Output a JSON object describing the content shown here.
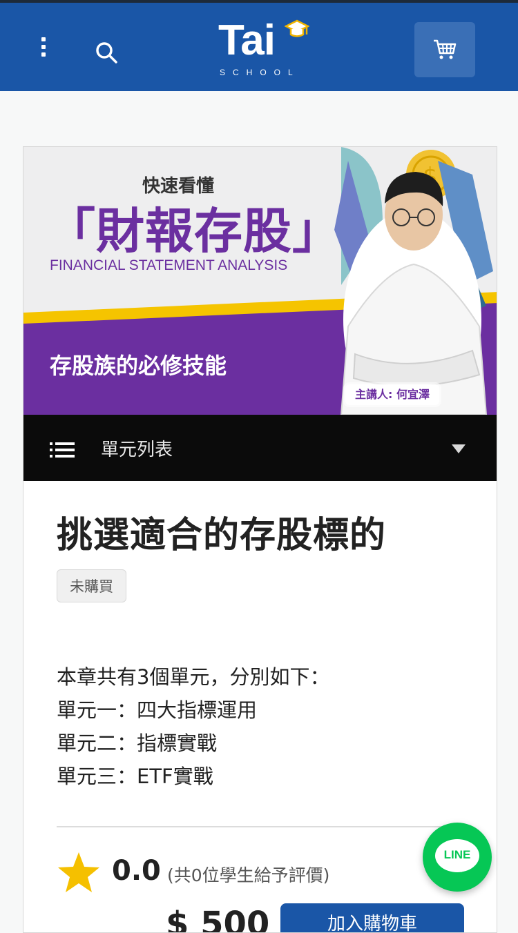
{
  "header": {
    "logo_text": "Tai",
    "logo_sub": "SCHOOL",
    "menu_icon": "kebab-menu-icon",
    "search_icon": "search-icon",
    "cart_icon": "shopping-cart-icon",
    "brand_color": "#1a56a7"
  },
  "banner": {
    "kicker": "快速看懂",
    "title": "「財報存股」",
    "subtitle_en": "FINANCIAL STATEMENT ANALYSIS",
    "tagline": "存股族的必修技能",
    "speaker": "主講人: 何宜澤",
    "accent_color": "#6b2fa0",
    "stripe_color": "#f5c400"
  },
  "unit_bar": {
    "label": "單元列表",
    "list_icon": "list-icon",
    "caret_icon": "caret-down-icon"
  },
  "course": {
    "title": "挑選適合的存股標的",
    "status": "未購買",
    "description": [
      "本章共有3個單元，分別如下：",
      "單元一：四大指標運用",
      "單元二：指標實戰",
      "單元三：ETF實戰"
    ],
    "rating_value": "0.0",
    "rating_count": "(共0位學生給予評價)",
    "price": "$ 500",
    "add_to_cart": "加入購物車"
  },
  "line_button": {
    "label": "LINE",
    "color": "#06c755"
  }
}
